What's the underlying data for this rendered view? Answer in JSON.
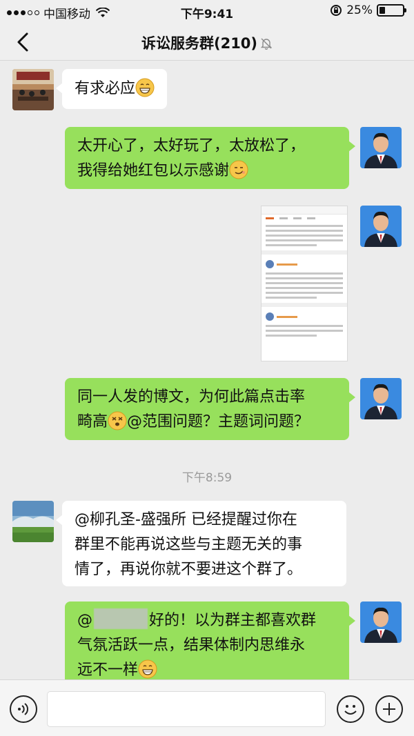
{
  "status_bar": {
    "carrier": "中国移动",
    "time": "下午9:41",
    "battery_percent": "25%",
    "battery_level": 0.25
  },
  "nav": {
    "title": "诉讼服务群(210)",
    "back_icon": "chevron-left-icon",
    "mute_icon": "bell-muted-icon"
  },
  "messages": [
    {
      "id": "m1",
      "side": "in",
      "text": "有求必应",
      "emoji": "grin-emoji"
    },
    {
      "id": "m2",
      "side": "out",
      "lines": [
        "太开心了，太好玩了，太放松了，",
        "我得给她红包以示感谢"
      ],
      "emoji": "smirk-emoji"
    },
    {
      "id": "m3",
      "side": "out",
      "type": "image"
    },
    {
      "id": "m4",
      "side": "out",
      "lines": [
        "同一人发的博文，为何此篇点击率",
        "畸高",
        "@范围问题？主题词问题？"
      ],
      "emoji": "dizzy-emoji"
    },
    {
      "id": "m5",
      "side": "in",
      "lines": [
        "@柳孔圣-盛强所 已经提醒过你在",
        "群里不能再说这些与主题无关的事",
        "情了，再说你就不要进这个群了。"
      ]
    },
    {
      "id": "m6",
      "side": "out",
      "lines": [
        "@",
        "好的！以为群主都喜欢群",
        "气氛活跃一点，结果体制内思维永",
        "远不一样"
      ],
      "emoji": "grin-emoji"
    }
  ],
  "timestamp": "下午8:59",
  "input_bar": {
    "voice_icon": "voice-icon",
    "emoji_icon": "smiley-icon",
    "plus_icon": "plus-icon"
  },
  "colors": {
    "out_bubble": "#97e05c",
    "in_bubble": "#ffffff",
    "background": "#ececec"
  }
}
